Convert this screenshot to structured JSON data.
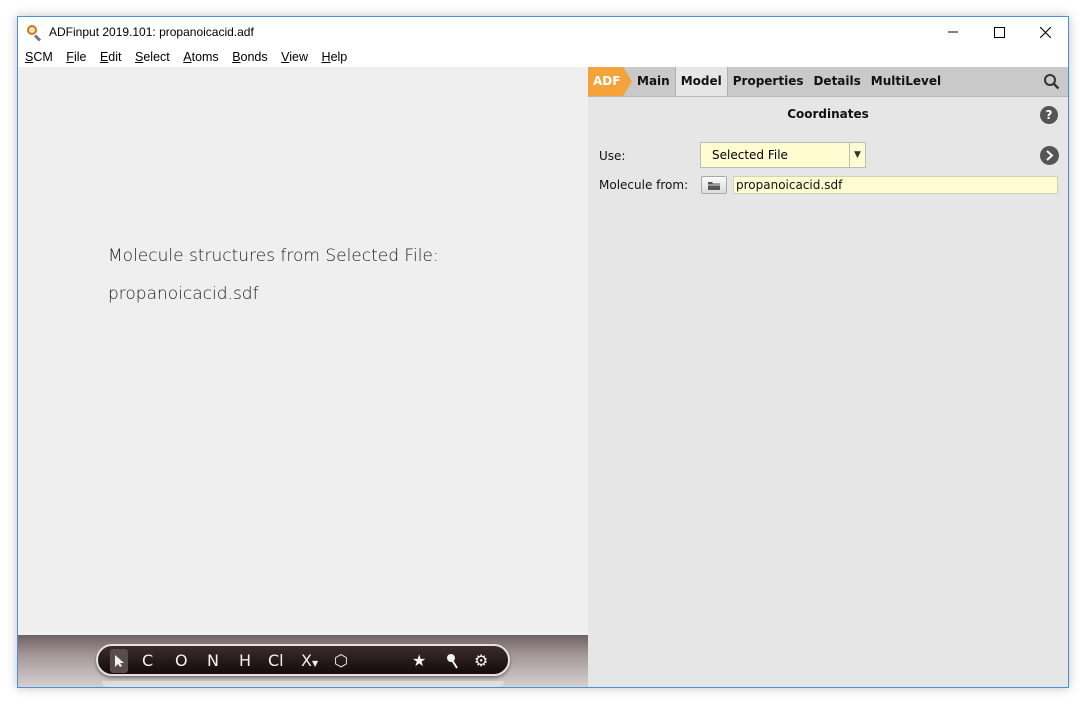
{
  "window": {
    "title": "ADFinput 2019.101: propanoicacid.adf"
  },
  "menubar": {
    "items": [
      {
        "label": "SCM",
        "accel": "S",
        "rest": "CM"
      },
      {
        "label": "File",
        "accel": "F",
        "rest": "ile"
      },
      {
        "label": "Edit",
        "accel": "E",
        "rest": "dit"
      },
      {
        "label": "Select",
        "accel": "S",
        "rest": "elect"
      },
      {
        "label": "Atoms",
        "accel": "A",
        "rest": "toms"
      },
      {
        "label": "Bonds",
        "accel": "B",
        "rest": "onds"
      },
      {
        "label": "View",
        "accel": "V",
        "rest": "iew"
      },
      {
        "label": "Help",
        "accel": "H",
        "rest": "elp"
      }
    ]
  },
  "viewer": {
    "line1": "Molecule structures from Selected File:",
    "line2": "propanoicacid.sdf"
  },
  "toolbar": {
    "tools": [
      {
        "name": "select-tool",
        "label": ""
      },
      {
        "name": "carbon-tool",
        "label": "C"
      },
      {
        "name": "oxygen-tool",
        "label": "O"
      },
      {
        "name": "nitrogen-tool",
        "label": "N"
      },
      {
        "name": "hydrogen-tool",
        "label": "H"
      },
      {
        "name": "chlorine-tool",
        "label": "Cl"
      },
      {
        "name": "other-element-tool",
        "label": "X"
      },
      {
        "name": "ring-tool",
        "label": "⬡"
      },
      {
        "name": "favorites-tool",
        "label": "★"
      },
      {
        "name": "edit-tool",
        "label": ""
      },
      {
        "name": "settings-tool",
        "label": "⚙"
      }
    ]
  },
  "panel": {
    "tabs": {
      "engine": "ADF",
      "main": "Main",
      "model": "Model",
      "properties": "Properties",
      "details": "Details",
      "multilevel": "MultiLevel"
    },
    "section_title": "Coordinates",
    "use_label": "Use:",
    "use_value": "Selected File",
    "molecule_from_label": "Molecule from:",
    "molecule_from_value": "propanoicacid.sdf",
    "help_label": "?"
  }
}
